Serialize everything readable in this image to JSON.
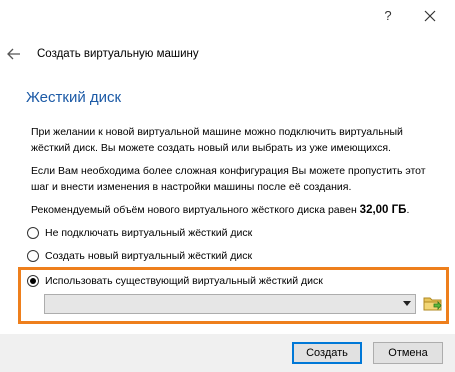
{
  "titlebar": {
    "help": "?",
    "close_icon": "close-icon"
  },
  "header": {
    "title": "Создать виртуальную машину",
    "back_icon": "back-arrow-icon"
  },
  "section": {
    "heading": "Жесткий диск"
  },
  "paragraphs": {
    "p1_line1": "При желании к новой виртуальной машине можно подключить виртуальный",
    "p1_line2": "жёсткий диск. Вы можете создать новый или выбрать из уже имеющихся.",
    "p2_line1": "Если Вам необходима более сложная конфигурация Вы можете пропустить этот",
    "p2_line2": "шаг и внести изменения в настройки машины после её создания.",
    "p3_text": "Рекомендуемый объём нового виртуального жёсткого диска равен ",
    "p3_value": "32,00 ГБ",
    "p3_end": "."
  },
  "options": {
    "no_disk": "Не подключать виртуальный жёсткий диск",
    "new_disk": "Создать новый виртуальный жёсткий диск",
    "existing_disk": "Использовать существующий виртуальный жёсткий диск",
    "selected": "existing_disk"
  },
  "disk_select": {
    "value": ""
  },
  "colors": {
    "heading": "#1c5aa6",
    "highlight": "#ee7f1c",
    "default_button_border": "#0078d7"
  },
  "buttons": {
    "create": "Создать",
    "cancel": "Отмена"
  }
}
